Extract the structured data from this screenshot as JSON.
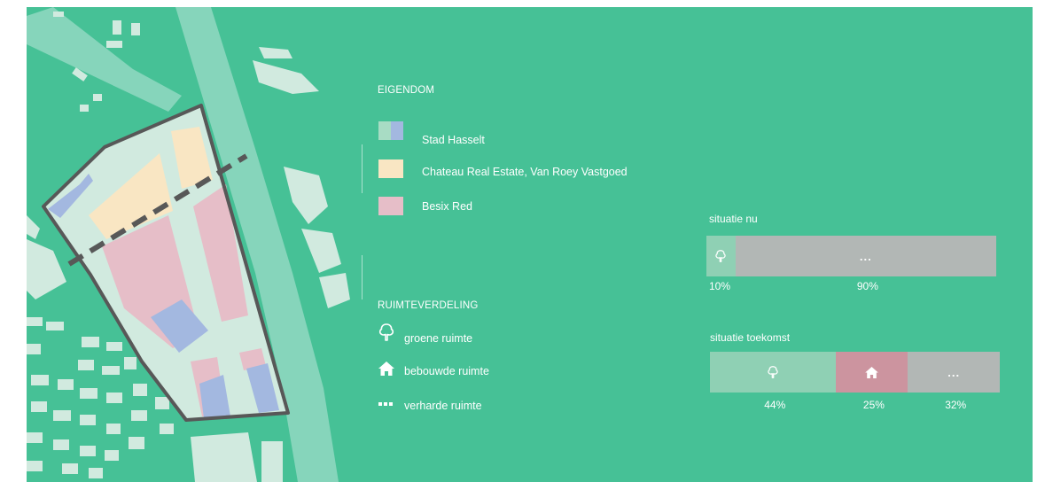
{
  "ownership": {
    "heading": "EIGENDOM",
    "items": [
      {
        "label": "Stad Hasselt",
        "colors": [
          "#a8dcc4",
          "#a3b8e0"
        ]
      },
      {
        "label": "Chateau Real Estate, Van Roey Vastgoed",
        "colors": [
          "#f9e6c3"
        ]
      },
      {
        "label": "Besix Red",
        "colors": [
          "#e6bec8"
        ]
      }
    ]
  },
  "space": {
    "heading": "RUIMTEVERDELING",
    "items": [
      {
        "label": "groene ruimte",
        "icon": "tree-icon"
      },
      {
        "label": "bebouwde ruimte",
        "icon": "house-icon"
      },
      {
        "label": "verharde ruimte",
        "icon": "dashes-icon"
      }
    ]
  },
  "chart_data": [
    {
      "type": "bar",
      "orientation": "horizontal-stacked",
      "title": "situatie nu",
      "categories": [
        "groene ruimte",
        "verharde ruimte"
      ],
      "values": [
        10,
        90
      ],
      "labels": [
        "10%",
        "90%"
      ],
      "segment_marks": [
        "tree-icon",
        "..."
      ],
      "colors": [
        "#8fd0b4",
        "#b2b7b5"
      ]
    },
    {
      "type": "bar",
      "orientation": "horizontal-stacked",
      "title": "situatie toekomst",
      "categories": [
        "groene ruimte",
        "bebouwde ruimte",
        "verharde ruimte"
      ],
      "values": [
        44,
        25,
        32
      ],
      "labels": [
        "44%",
        "25%",
        "32%"
      ],
      "segment_marks": [
        "tree-icon",
        "house-icon",
        "..."
      ],
      "colors": [
        "#8fd0b4",
        "#cc949f",
        "#b2b7b5"
      ]
    }
  ],
  "colors": {
    "background": "#46c196",
    "road": "#86d5bb",
    "building": "#d1eadf",
    "outline": "#585858"
  }
}
